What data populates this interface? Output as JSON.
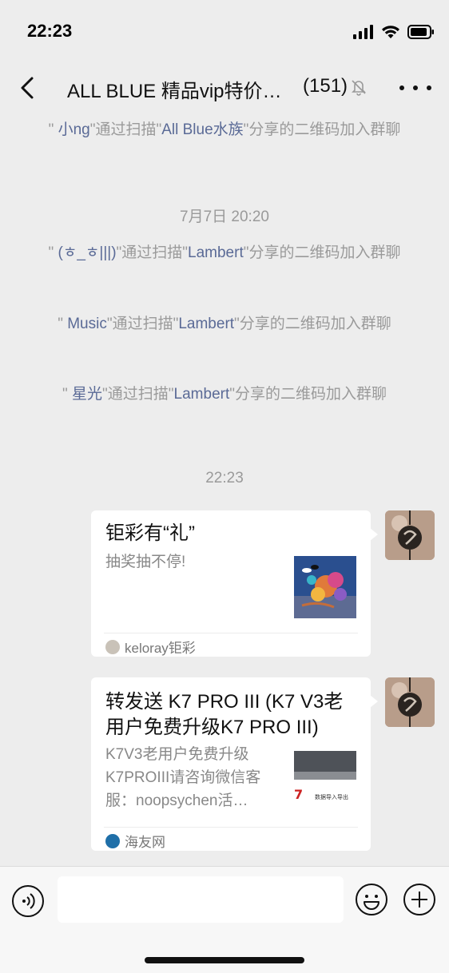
{
  "status_bar": {
    "time": "22:23"
  },
  "header": {
    "title": "ALL BLUE 精品vip特价…",
    "member_count": "(151)"
  },
  "messages": {
    "sys1": {
      "prefix": "\" ",
      "name": "小ng",
      "mid": "\"通过扫描\"",
      "sharer": "All Blue水族",
      "suffix": "\"分享的二维码加入群聊"
    },
    "time1": "7月7日 20:20",
    "sys2": {
      "prefix": "\" ",
      "name": "(ㅎ_ㅎ|||)",
      "mid": "\"通过扫描\"",
      "sharer": "Lambert",
      "suffix": "\"分享的二维码加入群聊"
    },
    "sys3": {
      "prefix": "\" ",
      "name": "Music",
      "mid": "\"通过扫描\"",
      "sharer": "Lambert",
      "suffix": "\"分享的二维码加入群聊"
    },
    "sys4": {
      "prefix": "\" ",
      "name": "星光",
      "mid": "\"通过扫描\"",
      "sharer": "Lambert",
      "suffix": "\"分享的二维码加入群聊"
    },
    "time2": "22:23"
  },
  "cards": [
    {
      "title": "钜彩有“礼”",
      "desc": "抽奖抽不停!",
      "source": "keloray钜彩",
      "thumb_icon": "aquarium-coral-thumbnail"
    },
    {
      "title_line1": "转发送 K7 PRO III (K7 V3老",
      "title_line2": "用户免费升级K7 PRO III)",
      "desc_line1": "K7V3老用户免费升级",
      "desc_line2": "K7PROIII请咨询微信客",
      "desc_line3": "服：noopsychen活…",
      "thumb_text": "数据导入导出",
      "source": "海友网",
      "thumb_icon": "k7-pro-product-thumbnail"
    }
  ],
  "colors": {
    "background": "#ededed",
    "system_name": "#5a6a96",
    "system_text": "#9a9a9a",
    "card": "#ffffff"
  }
}
